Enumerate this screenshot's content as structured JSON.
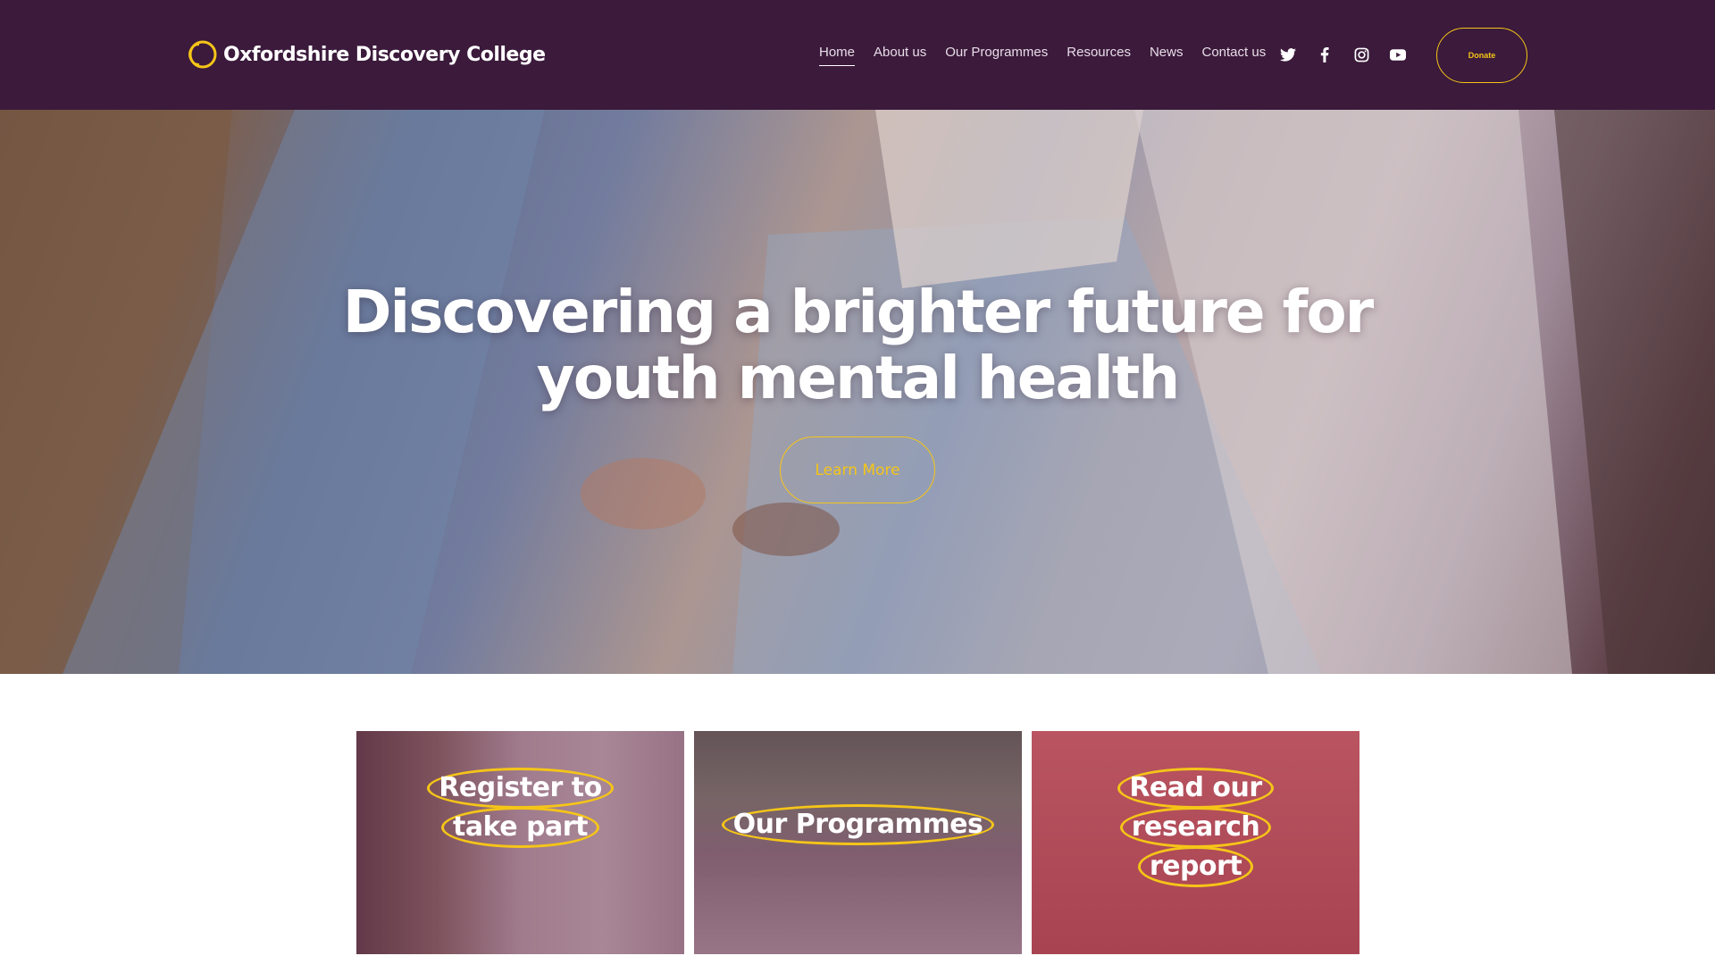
{
  "brand": {
    "name": "Oxfordshire Discovery College",
    "accent": "#f5c518",
    "header_bg": "#3b1a3b"
  },
  "nav": {
    "items": [
      {
        "label": "Home",
        "active": true
      },
      {
        "label": "About us"
      },
      {
        "label": "Our Programmes"
      },
      {
        "label": "Resources"
      },
      {
        "label": "News"
      },
      {
        "label": "Contact us"
      }
    ]
  },
  "socials": [
    {
      "icon": "twitter-icon"
    },
    {
      "icon": "facebook-icon"
    },
    {
      "icon": "instagram-icon"
    },
    {
      "icon": "youtube-icon"
    }
  ],
  "header": {
    "donate_label": "Donate"
  },
  "hero": {
    "title_line1": "Discovering a brighter future for",
    "title_line2": "youth mental health",
    "cta_label": "Learn More"
  },
  "cards": [
    {
      "lines": [
        "Register to",
        "take part"
      ]
    },
    {
      "lines": [
        "Our Programmes"
      ]
    },
    {
      "lines": [
        "Read our",
        "research",
        "report"
      ]
    }
  ]
}
